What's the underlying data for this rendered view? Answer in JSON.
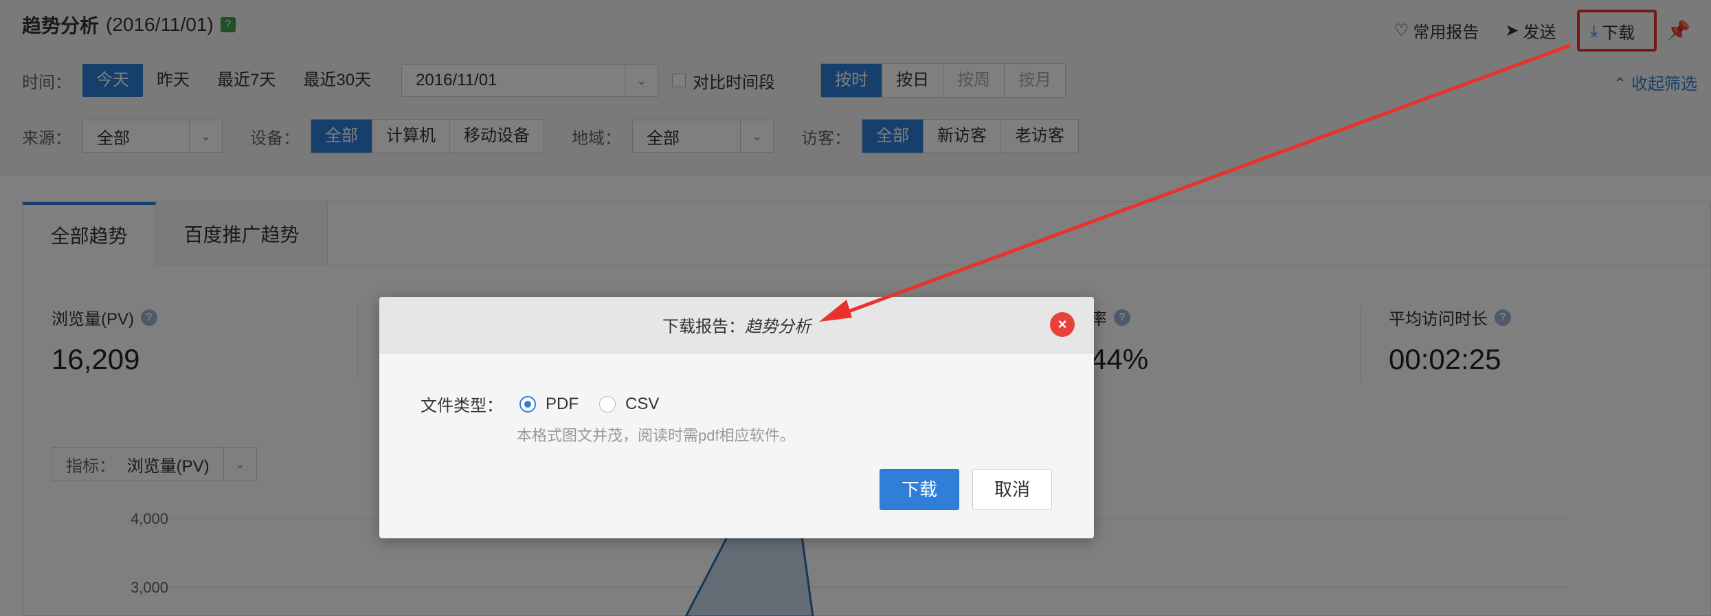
{
  "header": {
    "title": "趋势分析",
    "date": "(2016/11/01)",
    "help_badge": "?",
    "tools": {
      "favorites": "常用报告",
      "send": "发送",
      "download": "下载"
    },
    "collapse": "收起筛选"
  },
  "filters": {
    "time_label": "时间：",
    "time_options": [
      "今天",
      "昨天",
      "最近7天",
      "最近30天"
    ],
    "date_value": "2016/11/01",
    "compare_label": "对比时间段",
    "granularity": [
      "按时",
      "按日",
      "按周",
      "按月"
    ],
    "source_label": "来源：",
    "source_value": "全部",
    "device_label": "设备：",
    "device_options": [
      "全部",
      "计算机",
      "移动设备"
    ],
    "region_label": "地域：",
    "region_value": "全部",
    "visitor_label": "访客：",
    "visitor_options": [
      "全部",
      "新访客",
      "老访客"
    ]
  },
  "tabs": [
    "全部趋势",
    "百度推广趋势"
  ],
  "metrics": {
    "pv_label": "浏览量(PV)",
    "pv_value": "16,209",
    "rate_label": "率",
    "rate_value": "44%",
    "avg_label": "平均访问时长",
    "avg_value": "00:02:25"
  },
  "indicator": {
    "label": "指标：",
    "value": "浏览量(PV)"
  },
  "chart_data": {
    "type": "area",
    "ylabel": "",
    "yticks": [
      "4,000",
      "3,000"
    ],
    "note": "partially visible trend area, mostly hidden behind modal"
  },
  "modal": {
    "title_prefix": "下载报告：",
    "title_name": "趋势分析",
    "close": "×",
    "file_type_label": "文件类型：",
    "options": [
      "PDF",
      "CSV"
    ],
    "selected": "PDF",
    "hint": "本格式图文并茂，阅读时需pdf相应软件。",
    "ok": "下载",
    "cancel": "取消"
  },
  "colors": {
    "accent": "#2f7ed8",
    "highlight": "#e8322b",
    "close": "#e8413c"
  }
}
